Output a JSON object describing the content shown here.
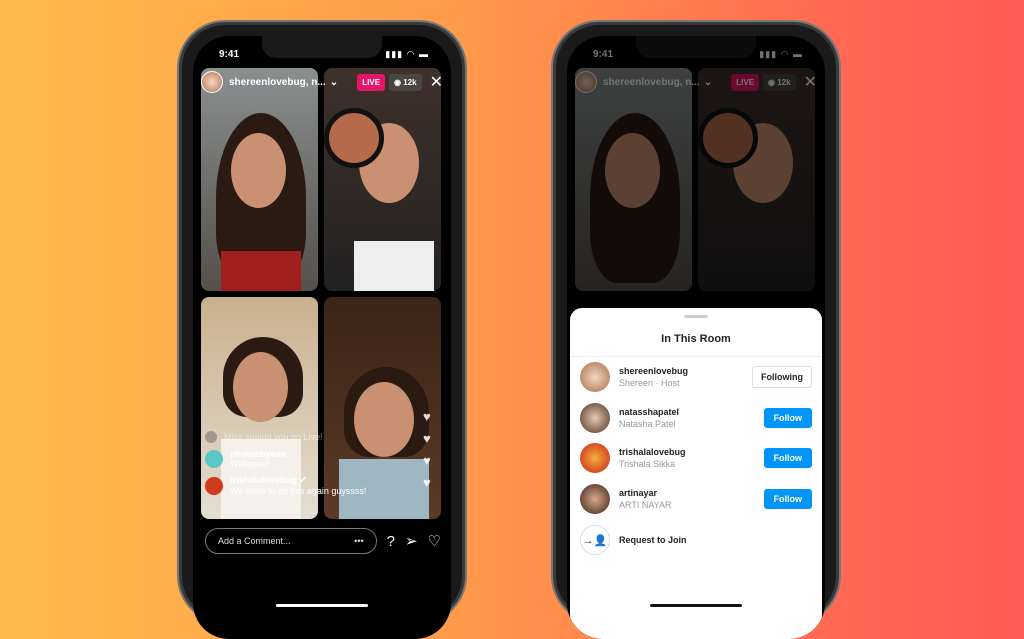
{
  "status": {
    "time": "9:41",
    "signal": "▮▮▮ ◠ ▬"
  },
  "live": {
    "host_label": "shereenlovebug, n...",
    "chevron": "⌄",
    "live_badge": "LIVE",
    "viewers": "◉ 12k",
    "close": "✕"
  },
  "comments": [
    {
      "user": "",
      "text": "Miss seeing you go Live!"
    },
    {
      "user": "photosbyean",
      "text": "Welcome!"
    },
    {
      "user": "trishalalovebug",
      "verified": "✔",
      "text": "We have to do this again guyssss!"
    }
  ],
  "comment_bar": {
    "placeholder": "Add a Comment...",
    "more": "•••",
    "question_icon": "?",
    "send_icon": "➢",
    "heart_icon": "♡"
  },
  "sheet": {
    "title": "In This Room",
    "members": [
      {
        "username": "shereenlovebug",
        "subtitle": "Shereen · Host",
        "button": "Following"
      },
      {
        "username": "natasshapatel",
        "subtitle": "Natasha Patel",
        "button": "Follow"
      },
      {
        "username": "trishalalovebug",
        "subtitle": "Trishala Sikka",
        "button": "Follow"
      },
      {
        "username": "artinayar",
        "subtitle": "ARTI NAYAR",
        "button": "Follow"
      }
    ],
    "request_label": "Request to Join",
    "request_icon": "→👤"
  },
  "colors": {
    "live": "#e6156a",
    "follow": "#0095f6"
  }
}
